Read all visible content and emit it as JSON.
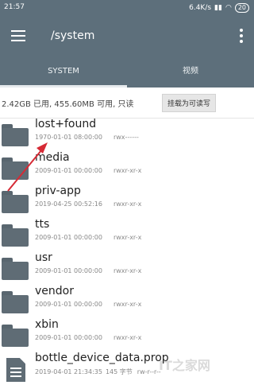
{
  "status_bar": {
    "time": "21:57",
    "network_speed": "6.4K/s",
    "battery": "20"
  },
  "header": {
    "title": "/system"
  },
  "tabs": [
    {
      "label": "SYSTEM"
    },
    {
      "label": "视频"
    }
  ],
  "storage": {
    "text": "2.42GB 已用, 455.60MB 可用, 只读",
    "mount_button": "挂载为可读写"
  },
  "files": [
    {
      "name": "lost+found",
      "date": "1970-01-01 08:00:00",
      "perms": "rwx------"
    },
    {
      "name": "media",
      "date": "2009-01-01 00:00:00",
      "perms": "rwxr-xr-x"
    },
    {
      "name": "priv-app",
      "date": "2019-04-25 00:52:16",
      "perms": "rwxr-xr-x"
    },
    {
      "name": "tts",
      "date": "2009-01-01 00:00:00",
      "perms": "rwxr-xr-x"
    },
    {
      "name": "usr",
      "date": "2009-01-01 00:00:00",
      "perms": "rwxr-xr-x"
    },
    {
      "name": "vendor",
      "date": "2009-01-01 00:00:00",
      "perms": "rwxr-xr-x"
    },
    {
      "name": "xbin",
      "date": "2009-01-01 00:00:00",
      "perms": "rwxr-xr-x"
    },
    {
      "name": "bottle_device_data.prop",
      "date": "2019-04-01 21:34:35",
      "size": "145 字节",
      "perms": "rw-r--r--"
    }
  ],
  "watermark": "IT之家网",
  "colors": {
    "toolbar": "#5d6f7b",
    "folder_icon": "#5f6c75",
    "annotation_arrow": "#d62a35"
  }
}
